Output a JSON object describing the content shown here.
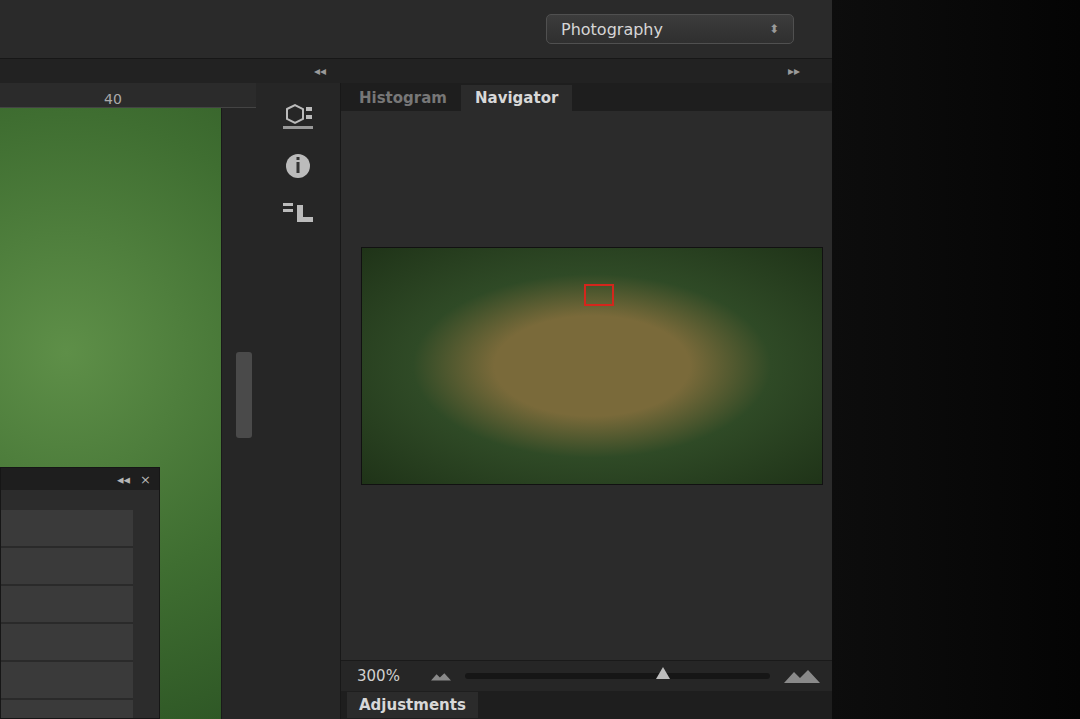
{
  "topbar": {
    "workspace": {
      "label": "Photography",
      "icon": "⬍"
    },
    "collapse_right": "▸▸",
    "collapse_left": "◂◂"
  },
  "ruler": {
    "ticks": [
      "40"
    ]
  },
  "canvas": {
    "scroll_level": 0.4
  },
  "floating_panel": {
    "collapse": "◂◂",
    "close": "×"
  },
  "tabs": [
    {
      "label": "Histogram",
      "selected": false
    },
    {
      "label": "Navigator",
      "selected": true
    }
  ],
  "navigator": {
    "zoom": "300%",
    "zoom_level": 0.65
  },
  "adjustments": {
    "label": "Adjustments"
  }
}
